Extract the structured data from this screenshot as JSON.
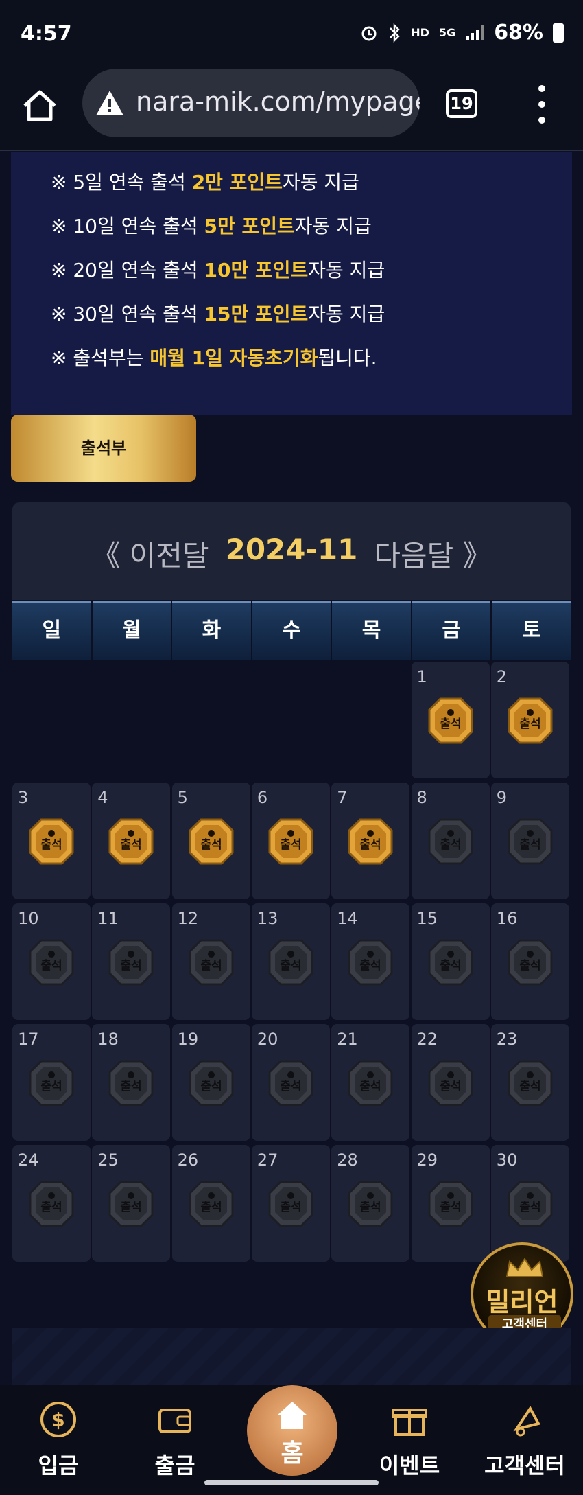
{
  "status_bar": {
    "time": "4:57",
    "battery": "68%",
    "icons": [
      "alarm-icon",
      "bluetooth-icon",
      "hd-voice-icon",
      "5g-icon",
      "signal-icon",
      "battery-icon"
    ],
    "hd_label": "HD",
    "net_label": "5G"
  },
  "browser": {
    "url": "nara-mik.com/mypage",
    "tab_count": "19"
  },
  "notice": {
    "lines": [
      {
        "prefix": "※ 5일 연속 출석 ",
        "highlight": "2만 포인트",
        "suffix": "자동 지급"
      },
      {
        "prefix": "※ 10일 연속 출석 ",
        "highlight": "5만 포인트",
        "suffix": "자동 지급"
      },
      {
        "prefix": "※ 20일 연속 출석 ",
        "highlight": "10만 포인트",
        "suffix": "자동 지급"
      },
      {
        "prefix": "※ 30일 연속 출석 ",
        "highlight": "15만 포인트",
        "suffix": "자동 지급"
      },
      {
        "prefix": "※ 출석부는 ",
        "highlight": "매월 1일 자동초기화",
        "suffix": "됩니다."
      }
    ]
  },
  "attendance_button": "출석부",
  "calendar": {
    "prev_label": "《 이전달",
    "month": "2024-11",
    "next_label": "다음달 》",
    "weekdays": [
      "일",
      "월",
      "화",
      "수",
      "목",
      "금",
      "토"
    ],
    "badge_label": "출석",
    "first_weekday": 5,
    "days_in_month": 30,
    "attended_days": [
      1,
      2,
      3,
      4,
      5,
      6,
      7
    ]
  },
  "cs_logo": {
    "title": "밀리언",
    "subtitle": "고객센터"
  },
  "bottom_nav": {
    "deposit": "입금",
    "withdraw": "출금",
    "home": "홈",
    "event": "이벤트",
    "support": "고객센터"
  },
  "colors": {
    "highlight": "#f7c62f",
    "gold_badge": "#e4a73a",
    "inactive_badge": "#3a3d45",
    "panel": "#161b45"
  }
}
